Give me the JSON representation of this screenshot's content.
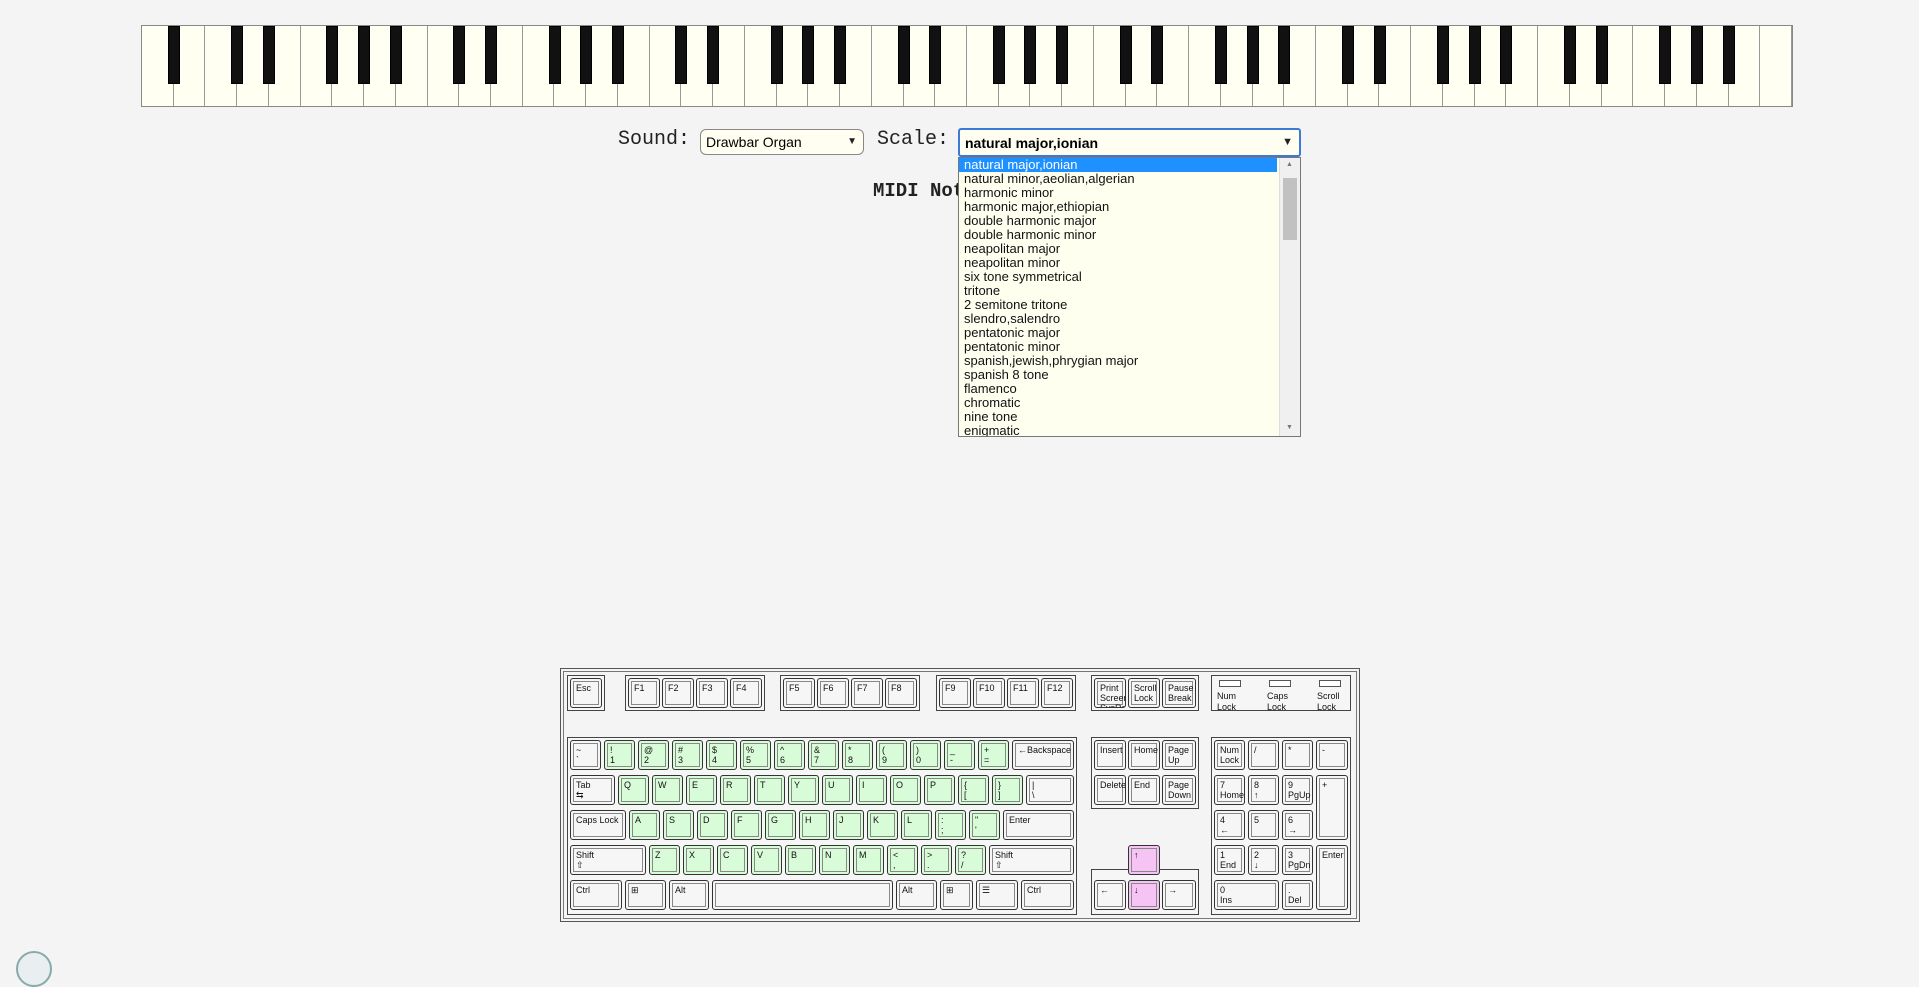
{
  "controls": {
    "sound_label": "Sound:",
    "sound_value": "Drawbar Organ",
    "scale_label": "Scale:",
    "scale_value": "natural major,ionian",
    "midi_label": "MIDI Notes"
  },
  "scale_options": [
    "natural major,ionian",
    "natural minor,aeolian,algerian",
    "harmonic minor",
    "harmonic major,ethiopian",
    "double harmonic major",
    "double harmonic minor",
    "neapolitan major",
    "neapolitan minor",
    "six tone symmetrical",
    "tritone",
    "2 semitone tritone",
    "slendro,salendro",
    "pentatonic major",
    "pentatonic minor",
    "spanish,jewish,phrygian major",
    "spanish 8 tone",
    "flamenco",
    "chromatic",
    "nine tone",
    "enigmatic"
  ],
  "selected_scale_index": 0,
  "colors": {
    "highlight_green": "#d8fbd8",
    "highlight_pink": "#f6c4f4",
    "selection_blue": "#1e90ff"
  },
  "keyboard": {
    "esc": "Esc",
    "f1": "F1",
    "f2": "F2",
    "f3": "F3",
    "f4": "F4",
    "f5": "F5",
    "f6": "F6",
    "f7": "F7",
    "f8": "F8",
    "f9": "F9",
    "f10": "F10",
    "f11": "F11",
    "f12": "F12",
    "prtsc": "Print\nScreen\nSysRq",
    "scrlk": "Scroll\nLock",
    "pause": "Pause\nBreak",
    "num_lock_led": "Num\nLock",
    "caps_lock_led": "Caps\nLock",
    "scroll_lock_led": "Scroll\nLock",
    "row1": [
      "~\n`",
      "!\n1",
      "@\n2",
      "#\n3",
      "$\n4",
      "%\n5",
      "^\n6",
      "&\n7",
      "*\n8",
      "(\n9",
      ")\n0",
      "_\n-",
      "+\n="
    ],
    "backspace": "←Backspace",
    "tab": "Tab\n⇆",
    "row2": [
      "Q",
      "W",
      "E",
      "R",
      "T",
      "Y",
      "U",
      "I",
      "O",
      "P",
      "{\n[",
      "}\n]"
    ],
    "backslash": "|\n\\",
    "caps": "Caps Lock",
    "row3": [
      "A",
      "S",
      "D",
      "F",
      "G",
      "H",
      "J",
      "K",
      "L",
      ":\n;",
      "\"\n'"
    ],
    "enter": "Enter",
    "shift": "Shift\n⇧",
    "row4": [
      "Z",
      "X",
      "C",
      "V",
      "B",
      "N",
      "M",
      "<\n,",
      ">\n.",
      "?\n/"
    ],
    "ctrl": "Ctrl",
    "win": "⊞",
    "alt": "Alt",
    "menu": "☰",
    "insert": "Insert",
    "home": "Home",
    "pgup": "Page\nUp",
    "delete": "Delete",
    "end": "End",
    "pgdn": "Page\nDown",
    "up": "↑",
    "left": "←",
    "down": "↓",
    "right": "→",
    "numlock": "Num\nLock",
    "divide": "/",
    "multiply": "*",
    "minus": "-",
    "n7": "7\nHome",
    "n8": "8\n↑",
    "n9": "9\nPgUp",
    "plus": "+",
    "n4": "4\n←",
    "n5": "5",
    "n6": "6\n→",
    "n1": "1\nEnd",
    "n2": "2\n↓",
    "n3": "3\nPgDn",
    "nenter": "Enter",
    "n0": "0\nIns",
    "ndel": ".\nDel"
  }
}
